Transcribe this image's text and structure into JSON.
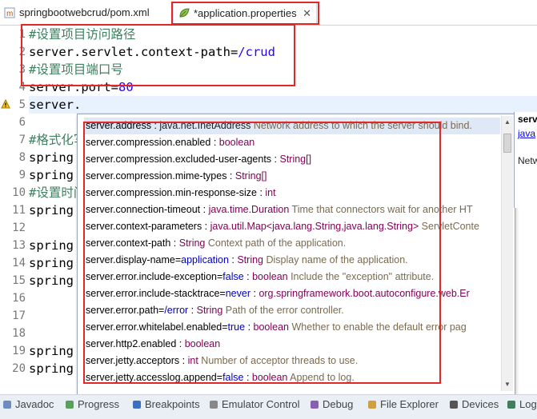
{
  "tabs": [
    {
      "label": "springbootwebcrud/pom.xml",
      "icon": "maven-icon"
    },
    {
      "label": "*application.properties",
      "icon": "leaf-properties-icon",
      "close": "✕"
    }
  ],
  "line_numbers": [
    "1",
    "2",
    "3",
    "4",
    "5",
    "6",
    "7",
    "8",
    "9",
    "10",
    "11",
    "12",
    "13",
    "14",
    "15",
    "16",
    "17",
    "18",
    "19",
    "20"
  ],
  "code": {
    "l1": "#设置项目访问路径",
    "l2_key": "server.servlet.context-path=",
    "l2_val": "/crud",
    "l3": "#设置项目端口号",
    "l4_key": "server.port=",
    "l4_val": "80",
    "l5": "server.",
    "l7": "#格式化写",
    "l8": "spring",
    "l9": "spring",
    "l10": "#设置时间",
    "l11": "spring",
    "l13": "spring",
    "l14": "spring",
    "l15": "spring",
    "l19": "spring",
    "l20": "spring"
  },
  "popup": {
    "items": [
      {
        "name": "server.address",
        "sep": " : ",
        "type": "java.net.InetAddress",
        "desc": " Network address to which the server should bind."
      },
      {
        "name": "server.compression.enabled",
        "sep": " : ",
        "type": "boolean",
        "desc": ""
      },
      {
        "name": "server.compression.excluded-user-agents",
        "sep": " : ",
        "type": "String[]",
        "desc": ""
      },
      {
        "name": "server.compression.mime-types",
        "sep": " : ",
        "type": "String[]",
        "desc": ""
      },
      {
        "name": "server.compression.min-response-size",
        "sep": " : ",
        "type": "int",
        "desc": ""
      },
      {
        "name": "server.connection-timeout",
        "sep": " : ",
        "type": "java.time.Duration",
        "desc": " Time that connectors wait for another HT"
      },
      {
        "name": "server.context-parameters",
        "sep": " : ",
        "type": "java.util.Map<java.lang.String,java.lang.String>",
        "desc": " ServletConte"
      },
      {
        "name": "server.context-path",
        "sep": " : ",
        "type": "String",
        "desc": " Context path of the application."
      },
      {
        "name": "server.display-name=",
        "val": "application",
        "sep": " : ",
        "type": "String",
        "desc": " Display name of the application."
      },
      {
        "name": "server.error.include-exception=",
        "val": "false",
        "sep": " : ",
        "type": "boolean",
        "desc": " Include the \"exception\" attribute."
      },
      {
        "name": "server.error.include-stacktrace=",
        "val": "never",
        "sep": " : ",
        "type": "org.springframework.boot.autoconfigure.web.Er",
        "desc": ""
      },
      {
        "name": "server.error.path=",
        "val": "/error",
        "sep": " : ",
        "type": "String",
        "desc": " Path of the error controller."
      },
      {
        "name": "server.error.whitelabel.enabled=",
        "val": "true",
        "sep": " : ",
        "type": "boolean",
        "desc": " Whether to enable the default error pag"
      },
      {
        "name": "server.http2.enabled",
        "sep": " : ",
        "type": "boolean",
        "desc": ""
      },
      {
        "name": "server.jetty.acceptors",
        "sep": " : ",
        "type": "int",
        "desc": " Number of acceptor threads to use."
      },
      {
        "name": "server.jetty.accesslog.append=",
        "val": "false",
        "sep": " : ",
        "type": "boolean",
        "desc": " Append to log."
      }
    ]
  },
  "doc_panel": {
    "title": "serv",
    "link": "java",
    "text": "Netw"
  },
  "bottom_tabs": [
    "Javadoc",
    "Progress",
    "Breakpoints",
    "Emulator Control",
    "Debug",
    "File Explorer",
    "Devices",
    "Log"
  ],
  "colors": {
    "highlight": "#e32626",
    "accent": "#2a00ff",
    "comment": "#3f7f5f"
  }
}
